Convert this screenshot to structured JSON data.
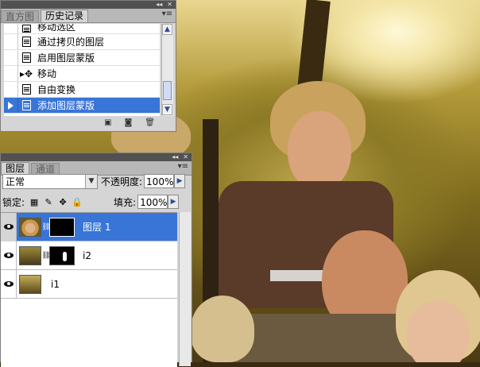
{
  "history_panel": {
    "tabs": [
      {
        "label": "直方图"
      },
      {
        "label": "历史记录"
      }
    ],
    "items": [
      {
        "label": "移动选区"
      },
      {
        "label": "通过拷贝的图层"
      },
      {
        "label": "启用图层蒙版"
      },
      {
        "label": "移动"
      },
      {
        "label": "自由变换"
      },
      {
        "label": "添加图层蒙版"
      }
    ],
    "selected_index": 5,
    "icons": [
      "new-document-from-state-icon",
      "new-snapshot-icon",
      "delete-state-icon"
    ]
  },
  "layers_panel": {
    "tabs": [
      {
        "label": "图层"
      },
      {
        "label": "通道"
      }
    ],
    "blend_mode": "正常",
    "opacity_label": "不透明度:",
    "opacity_value": "100%",
    "lock_label": "锁定:",
    "fill_label": "填充:",
    "fill_value": "100%",
    "layers": [
      {
        "name": "图层 1",
        "selected": true
      },
      {
        "name": "i2",
        "selected": false
      },
      {
        "name": "i1",
        "selected": false
      }
    ]
  },
  "colors": {
    "selection": "#3875d7",
    "panel": "#d5d5d5",
    "titlebar": "#515151"
  }
}
